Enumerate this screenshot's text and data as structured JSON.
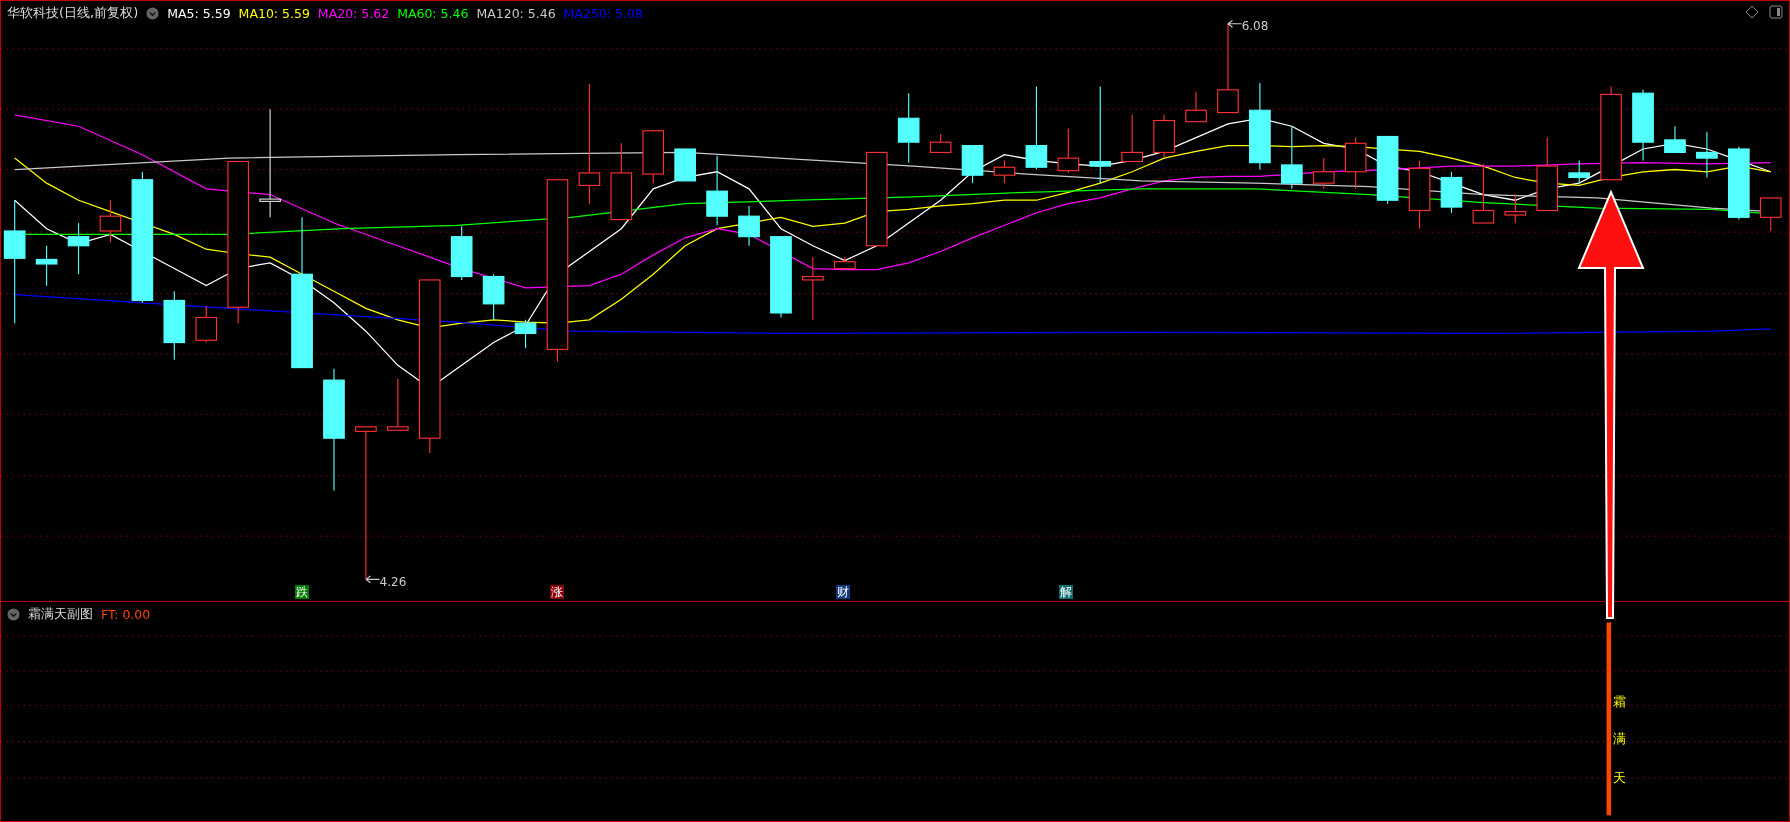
{
  "main_chart": {
    "title": "华软科技(日线,前复权)",
    "moving_averages": [
      {
        "label": "MA5: 5.59",
        "color": "#ffffff"
      },
      {
        "label": "MA10: 5.59",
        "color": "#ffff00"
      },
      {
        "label": "MA20: 5.62",
        "color": "#ff00ff"
      },
      {
        "label": "MA60: 5.46",
        "color": "#00ff00"
      },
      {
        "label": "MA120: 5.46",
        "color": "#c8c8c8"
      },
      {
        "label": "MA250: 5.08",
        "color": "#0000ff"
      }
    ],
    "high_label": "6.08",
    "low_label": "4.26",
    "event_markers": [
      {
        "label": "跌",
        "color": "#007a00"
      },
      {
        "label": "涨",
        "color": "#8a0000"
      },
      {
        "label": "财",
        "color": "#123a7a"
      },
      {
        "label": "解",
        "color": "#0f6f6f"
      }
    ]
  },
  "sub_chart": {
    "title": "霜满天副图",
    "value": "FT: 0.00",
    "signal_text": [
      "霜",
      "满",
      "天"
    ]
  }
}
